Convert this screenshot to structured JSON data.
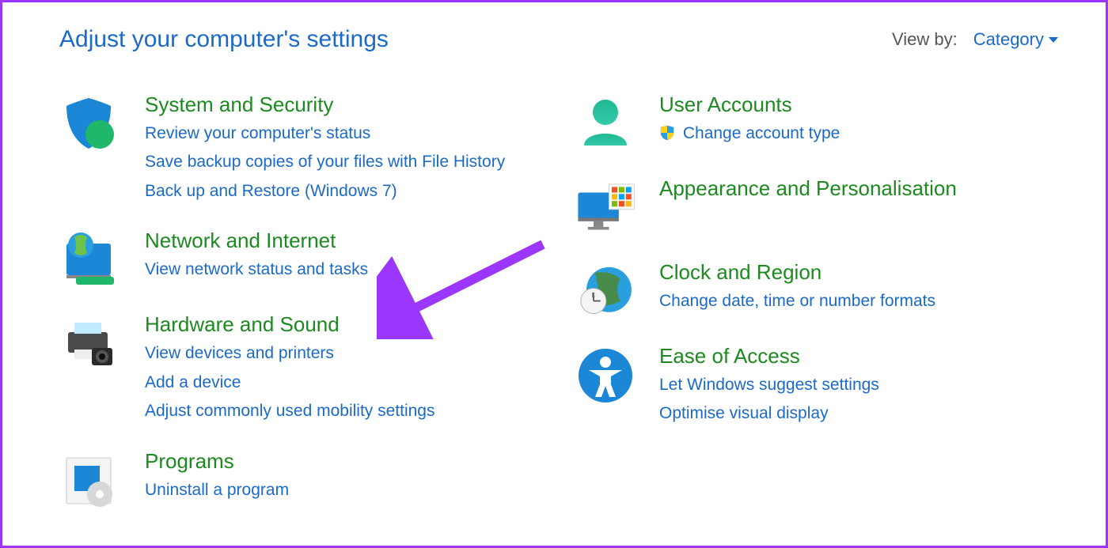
{
  "header": {
    "title": "Adjust your computer's settings",
    "view_by_label": "View by:",
    "view_by_value": "Category"
  },
  "left_column": [
    {
      "id": "system-security",
      "icon": "shield-icon",
      "title": "System and Security",
      "links": [
        "Review your computer's status",
        "Save backup copies of your files with File History",
        "Back up and Restore (Windows 7)"
      ]
    },
    {
      "id": "network-internet",
      "icon": "network-icon",
      "title": "Network and Internet",
      "links": [
        "View network status and tasks"
      ]
    },
    {
      "id": "hardware-sound",
      "icon": "printer-icon",
      "title": "Hardware and Sound",
      "links": [
        "View devices and printers",
        "Add a device",
        "Adjust commonly used mobility settings"
      ]
    },
    {
      "id": "programs",
      "icon": "programs-icon",
      "title": "Programs",
      "links": [
        "Uninstall a program"
      ]
    }
  ],
  "right_column": [
    {
      "id": "user-accounts",
      "icon": "user-accounts-icon",
      "title": "User Accounts",
      "links": [
        {
          "text": "Change account type",
          "shield": true
        }
      ]
    },
    {
      "id": "appearance",
      "icon": "appearance-icon",
      "title": "Appearance and Personalisation",
      "links": []
    },
    {
      "id": "clock-region",
      "icon": "clock-region-icon",
      "title": "Clock and Region",
      "links": [
        "Change date, time or number formats"
      ]
    },
    {
      "id": "ease-of-access",
      "icon": "ease-of-access-icon",
      "title": "Ease of Access",
      "links": [
        "Let Windows suggest settings",
        "Optimise visual display"
      ]
    }
  ],
  "annotation": {
    "arrow_color": "#9b36ff",
    "arrow_target": "hardware-sound"
  }
}
